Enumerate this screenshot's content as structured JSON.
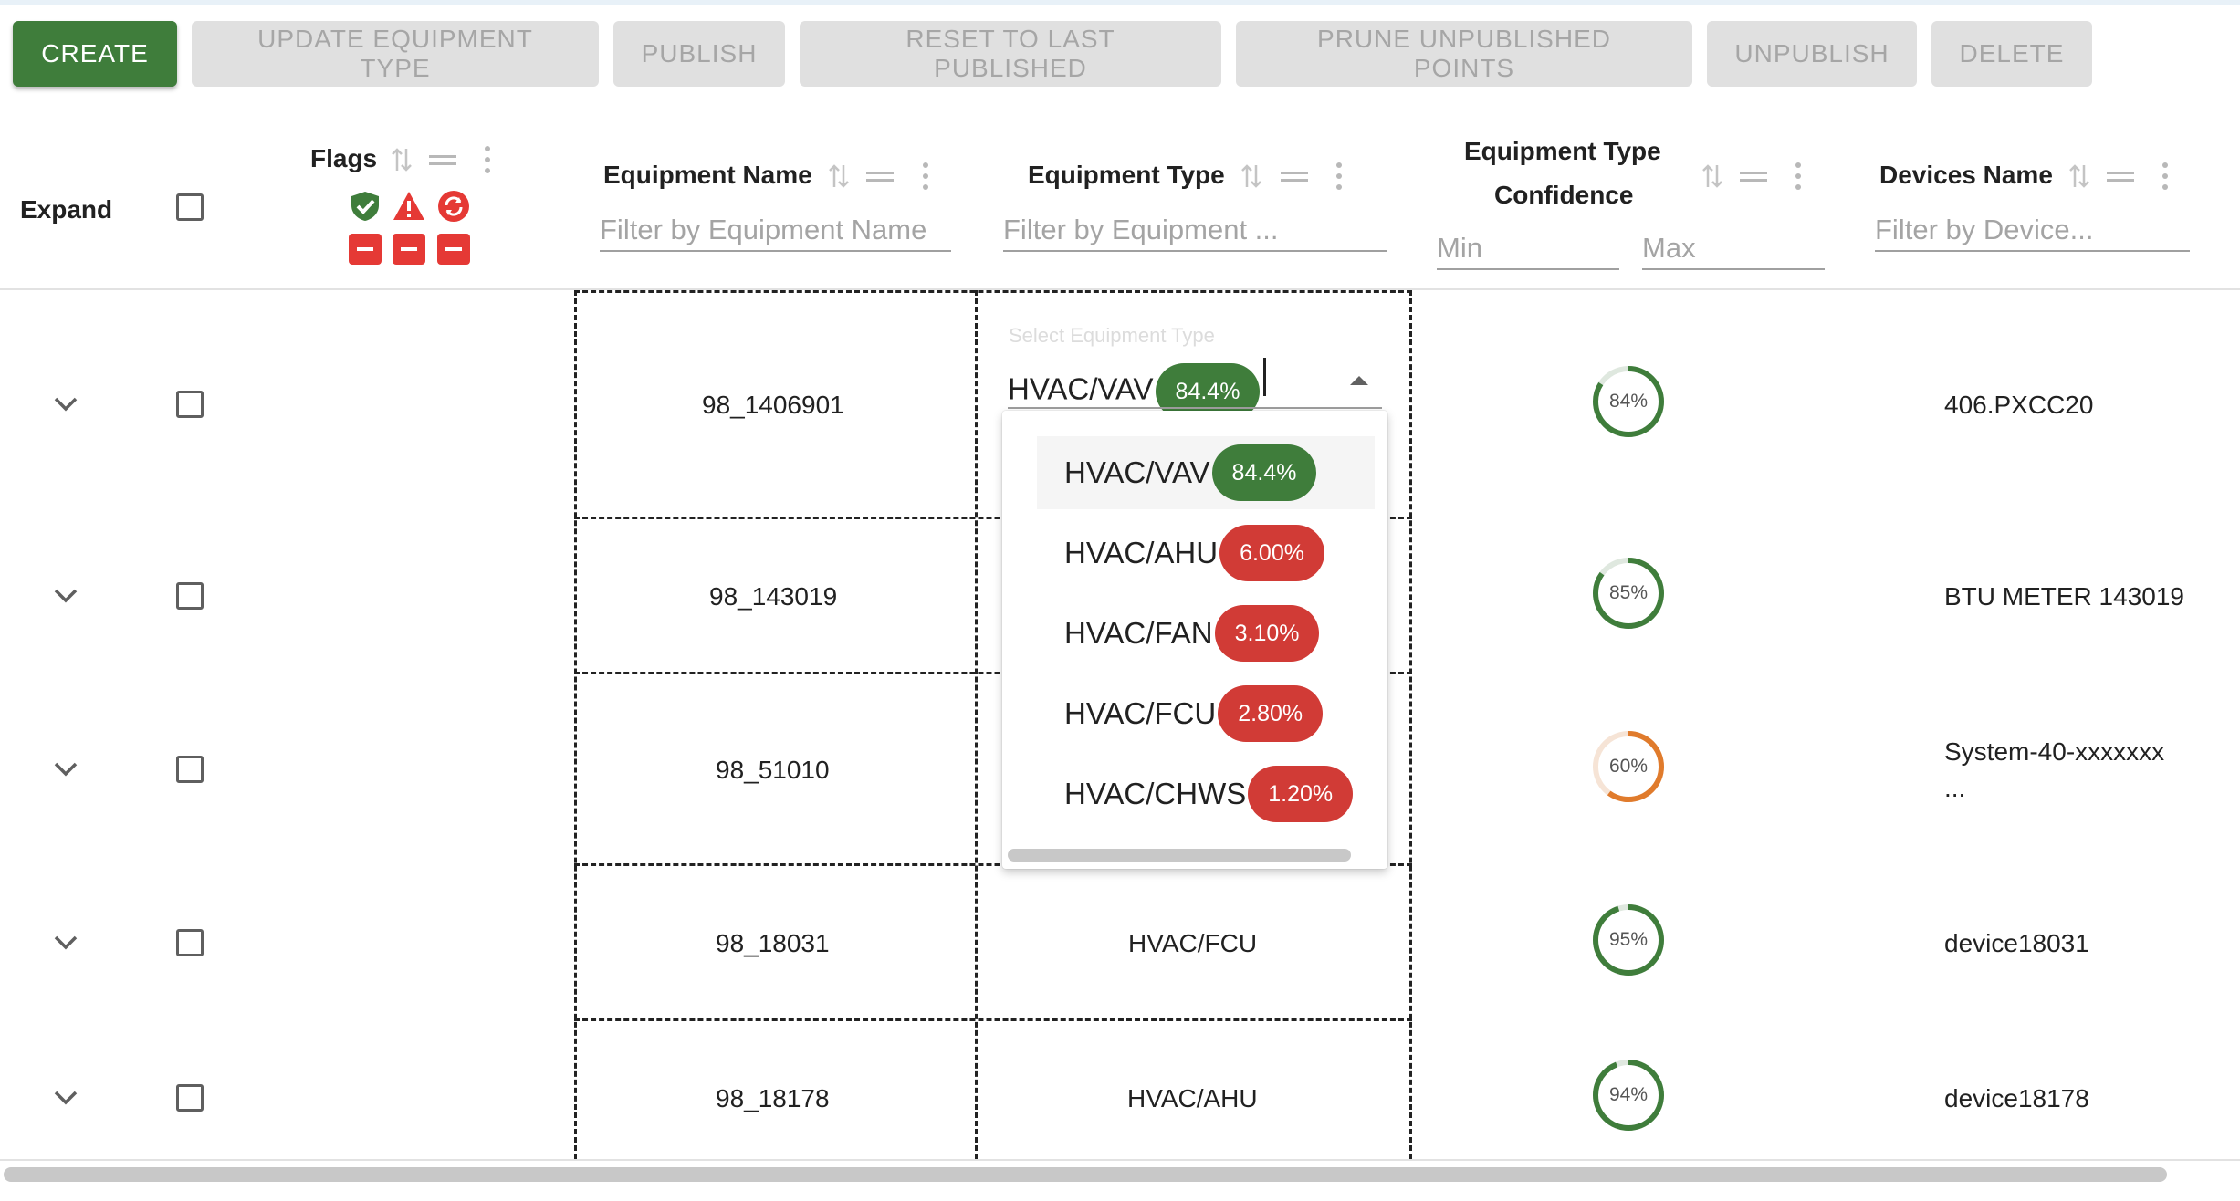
{
  "toolbar": {
    "create": "CREATE",
    "update_type": "UPDATE EQUIPMENT TYPE",
    "publish": "PUBLISH",
    "reset": "RESET TO LAST PUBLISHED",
    "prune": "PRUNE UNPUBLISHED POINTS",
    "unpublish": "UNPUBLISH",
    "delete": "DELETE"
  },
  "columns": {
    "expand": "Expand",
    "flags": "Flags",
    "equipment_name": "Equipment Name",
    "equipment_type": "Equipment Type",
    "confidence_line1": "Equipment Type",
    "confidence_line2": "Confidence",
    "devices_name": "Devices Name"
  },
  "filters": {
    "equipment_name": "Filter by Equipment Name",
    "equipment_type": "Filter by Equipment ...",
    "min": "Min",
    "max": "Max",
    "devices_name": "Filter by Device..."
  },
  "rows": [
    {
      "name": "98_1406901",
      "type": "",
      "confidence": "84%",
      "confidence_value": 84,
      "device": "406.PXCC20",
      "device_line2": ""
    },
    {
      "name": "98_143019",
      "type": "",
      "confidence": "85%",
      "confidence_value": 85,
      "device": "BTU METER 143019",
      "device_line2": ""
    },
    {
      "name": "98_51010",
      "type": "",
      "confidence": "60%",
      "confidence_value": 60,
      "device": "System-40-xxxxxxx",
      "device_line2": "..."
    },
    {
      "name": "98_18031",
      "type": "HVAC/FCU",
      "confidence": "95%",
      "confidence_value": 95,
      "device": "device18031",
      "device_line2": ""
    },
    {
      "name": "98_18178",
      "type": "HVAC/AHU",
      "confidence": "94%",
      "confidence_value": 94,
      "device": "device18178",
      "device_line2": ""
    }
  ],
  "select": {
    "label": "Select Equipment Type",
    "value": "HVAC/VAV",
    "value_pct": "84.4%"
  },
  "options": [
    {
      "label": "HVAC/VAV",
      "pct": "84.4%"
    },
    {
      "label": "HVAC/AHU",
      "pct": "6.00%"
    },
    {
      "label": "HVAC/FAN",
      "pct": "3.10%"
    },
    {
      "label": "HVAC/FCU",
      "pct": "2.80%"
    },
    {
      "label": "HVAC/CHWS",
      "pct": "1.20%"
    }
  ],
  "colors": {
    "primary": "#3f7d3b",
    "danger": "#d13b36",
    "warning_ring": "#e07b2c",
    "flag_red": "#e53935"
  }
}
